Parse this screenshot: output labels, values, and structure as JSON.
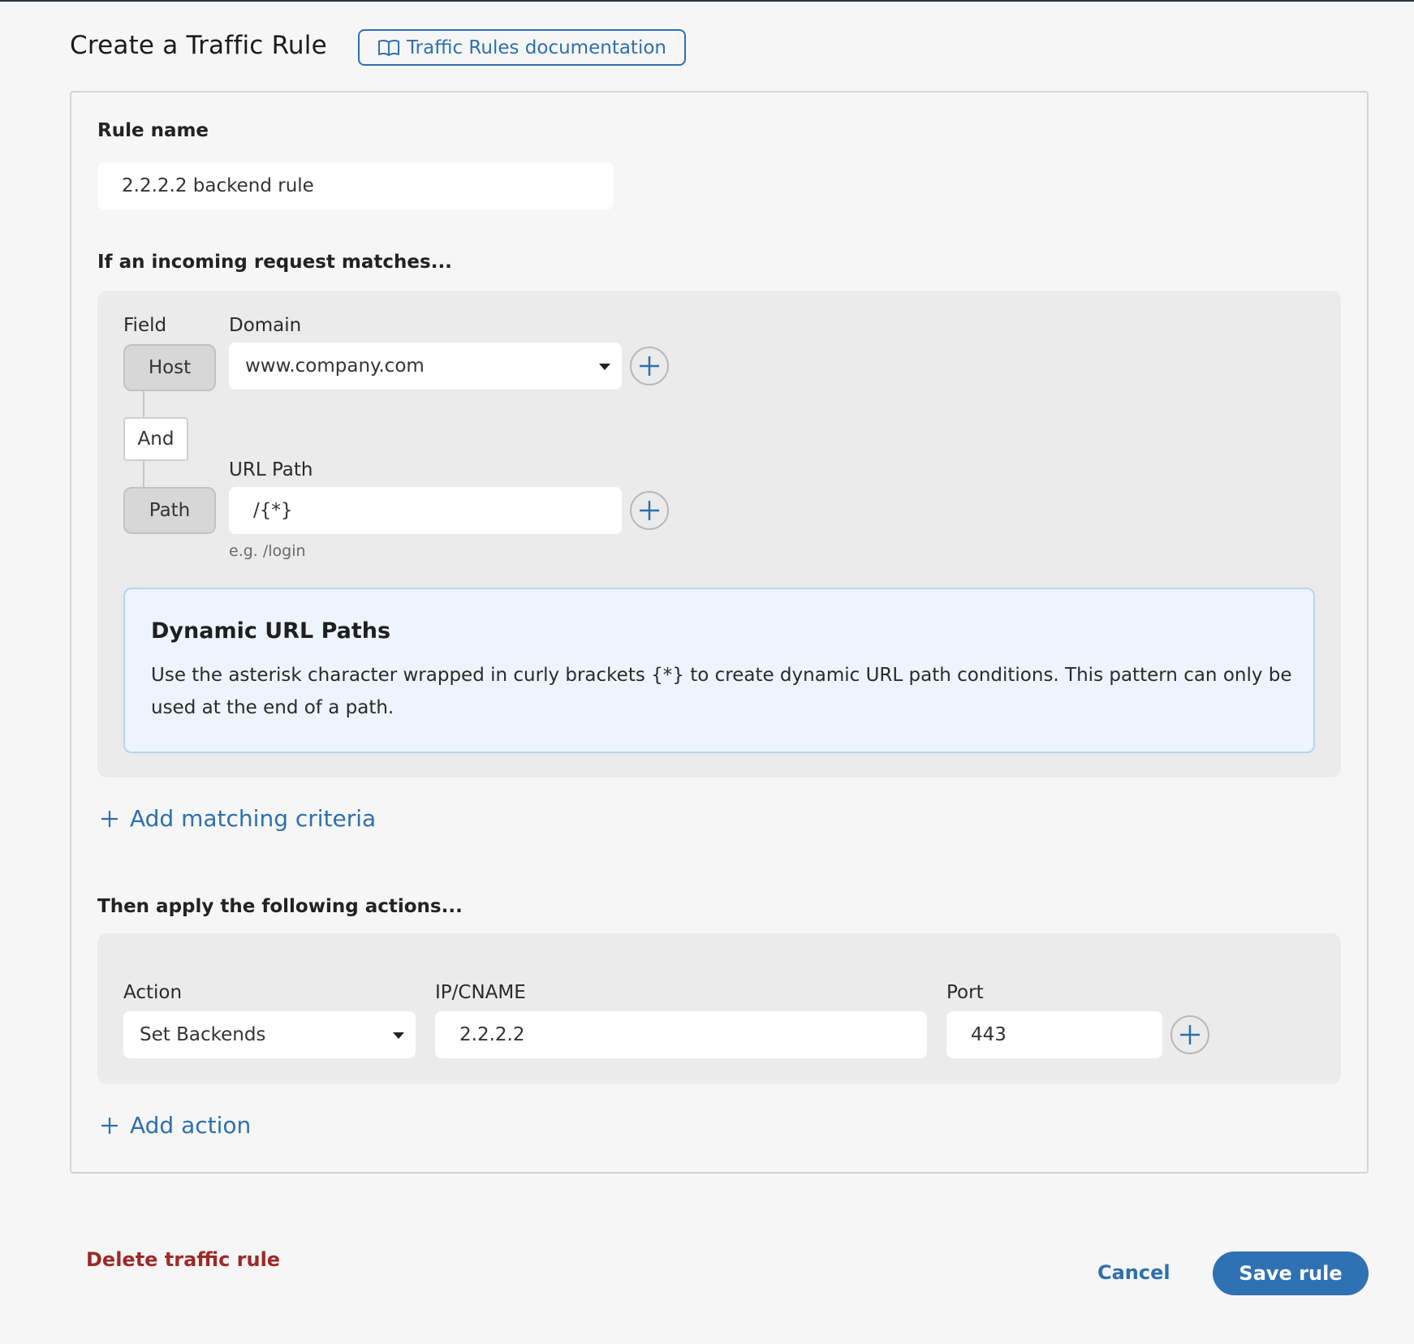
{
  "header": {
    "title": "Create a Traffic Rule",
    "doc_link_label": "Traffic Rules documentation",
    "doc_icon": "book-open-icon"
  },
  "rule_name": {
    "label": "Rule name",
    "value": "2.2.2.2 backend rule"
  },
  "matching": {
    "heading": "If an incoming request matches...",
    "field_column_label": "Field",
    "conditions": [
      {
        "field": "Host",
        "value_label": "Domain",
        "value": "www.company.com",
        "type": "select"
      },
      {
        "field": "Path",
        "value_label": "URL Path",
        "value": "/{*}",
        "type": "input",
        "hint": "e.g. /login"
      }
    ],
    "join_operator": "And",
    "info": {
      "title": "Dynamic URL Paths",
      "body": "Use the asterisk character wrapped in curly brackets {*} to create dynamic URL path conditions. This pattern can only be used at the end of a path."
    },
    "add_label": "Add matching criteria"
  },
  "actions": {
    "heading": "Then apply the following actions...",
    "action_label": "Action",
    "action_value": "Set Backends",
    "ip_label": "IP/CNAME",
    "ip_value": "2.2.2.2",
    "port_label": "Port",
    "port_value": "443",
    "add_label": "Add action"
  },
  "footer": {
    "delete_label": "Delete traffic rule",
    "cancel_label": "Cancel",
    "save_label": "Save rule"
  },
  "colors": {
    "accent": "#2e6fae",
    "primary_button": "#2f72b3",
    "danger": "#9d2a27",
    "info_bg": "#edf4fd",
    "panel_bg": "#ebebeb"
  }
}
